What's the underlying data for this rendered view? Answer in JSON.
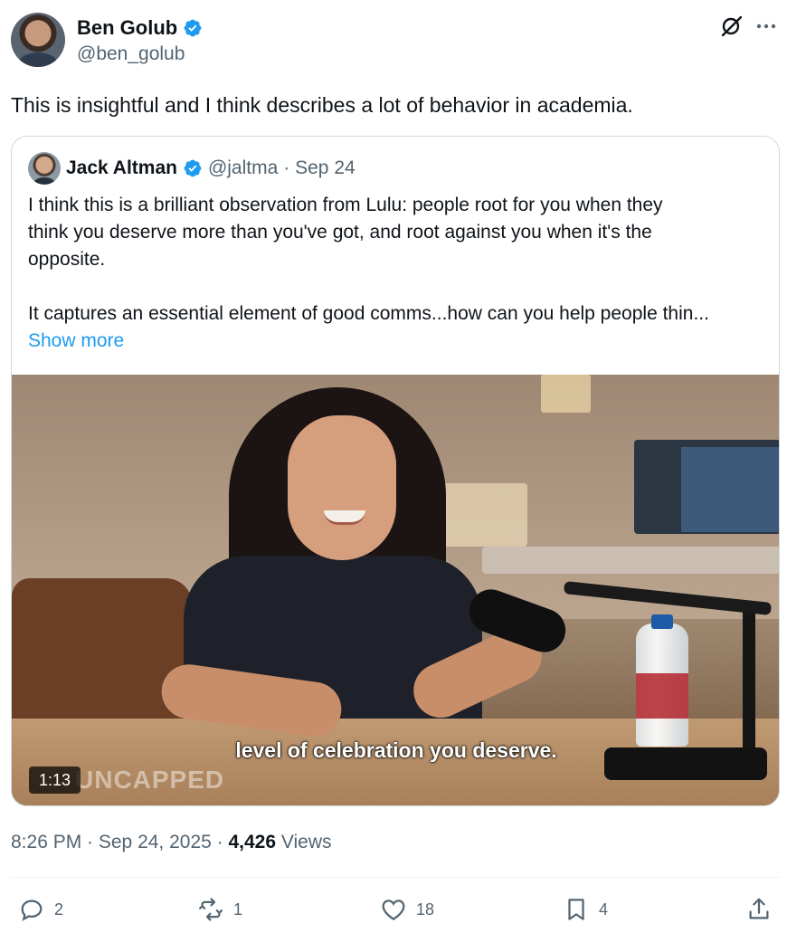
{
  "author": {
    "name": "Ben Golub",
    "handle": "@ben_golub",
    "verified_color": "#1d9bf0"
  },
  "header_icons": [
    "grok-icon",
    "more-icon"
  ],
  "tweet": {
    "text": "This is insightful and I think describes a lot of behavior in academia."
  },
  "quoted_tweet": {
    "name": "Jack Altman",
    "handle": "@jaltma",
    "date": "· Sep 24",
    "text_lines": [
      "I think this is a brilliant observation from Lulu: people root for you when they",
      "think you deserve more than you've got, and root against you when it's the",
      "opposite.",
      "It captures an essential element of good comms...how can you help people thin..."
    ],
    "show_more": "Show more",
    "media": {
      "caption": "level of celebration you deserve.",
      "watermark": "UNCAPPED",
      "duration": "1:13"
    }
  },
  "meta": {
    "time_date": "8:26 PM · Sep 24, 2025 · ",
    "views_count": "4,426",
    "views_label": " Views"
  },
  "actions": {
    "replies": "2",
    "reposts": "1",
    "likes": "18",
    "bookmarks": "4"
  },
  "colors": {
    "text": "#0f1419",
    "secondary": "#536471",
    "link": "#1d9bf0",
    "border": "#cfd9de"
  }
}
